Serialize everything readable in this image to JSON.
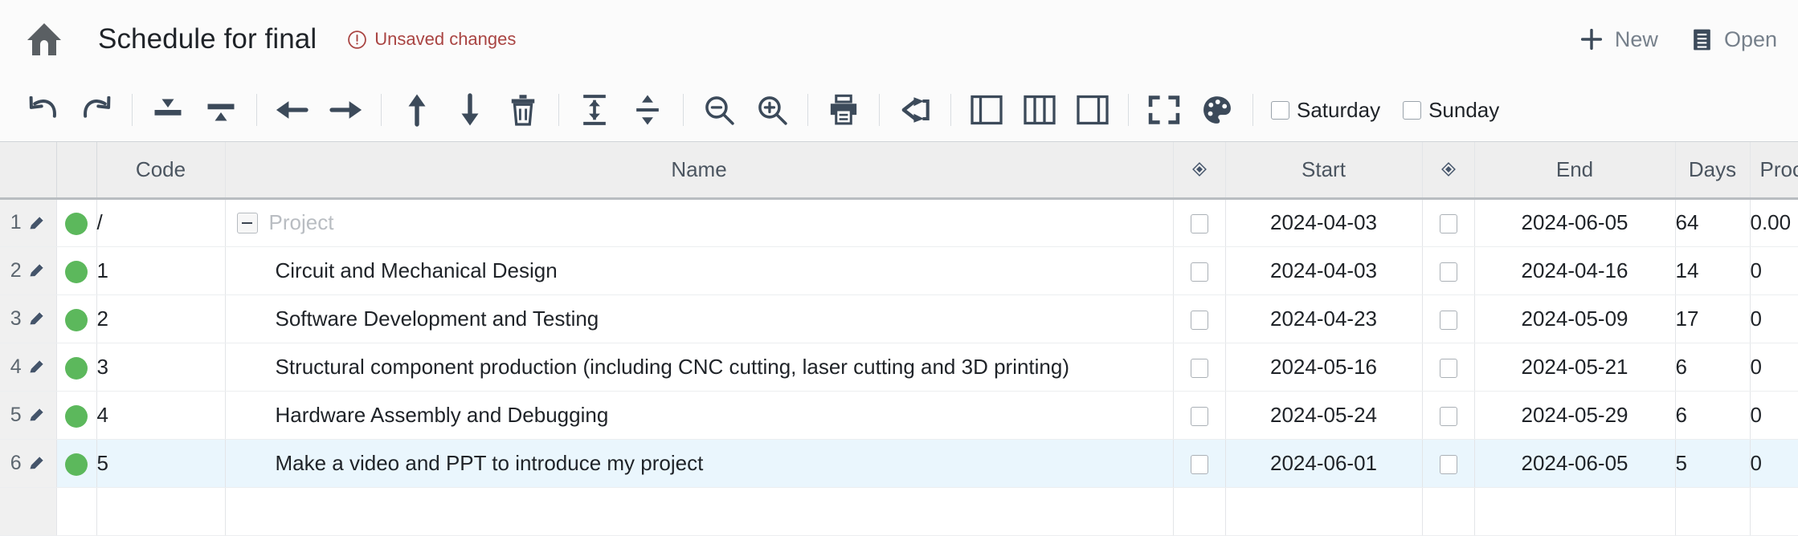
{
  "header": {
    "home_icon": "home-icon",
    "title": "Schedule for final",
    "unsaved_label": "Unsaved changes",
    "unsaved_color": "#a94442",
    "actions": [
      {
        "icon": "plus-icon",
        "label": "New"
      },
      {
        "icon": "document-icon",
        "label": "Open"
      }
    ]
  },
  "toolbar": {
    "groups": [
      {
        "buttons": [
          {
            "name": "undo-button",
            "icon": "undo-arrow-icon"
          },
          {
            "name": "redo-button",
            "icon": "redo-arrow-icon"
          }
        ]
      },
      {
        "buttons": [
          {
            "name": "insert-row-above-button",
            "icon": "insert-above-icon"
          },
          {
            "name": "insert-row-below-button",
            "icon": "insert-below-icon"
          }
        ]
      },
      {
        "buttons": [
          {
            "name": "outdent-button",
            "icon": "arrow-left-icon"
          },
          {
            "name": "indent-button",
            "icon": "arrow-right-icon"
          }
        ]
      },
      {
        "buttons": [
          {
            "name": "move-up-button",
            "icon": "arrow-up-icon"
          },
          {
            "name": "move-down-button",
            "icon": "arrow-down-icon"
          },
          {
            "name": "delete-row-button",
            "icon": "trash-icon"
          }
        ]
      },
      {
        "buttons": [
          {
            "name": "collapse-all-button",
            "icon": "collapse-rows-icon"
          },
          {
            "name": "expand-all-button",
            "icon": "expand-rows-icon"
          }
        ]
      },
      {
        "buttons": [
          {
            "name": "zoom-out-button",
            "icon": "magnifier-minus-icon"
          },
          {
            "name": "zoom-in-button",
            "icon": "magnifier-plus-icon"
          }
        ]
      },
      {
        "buttons": [
          {
            "name": "print-button",
            "icon": "printer-icon"
          }
        ]
      },
      {
        "buttons": [
          {
            "name": "dependency-button",
            "icon": "share-branch-icon"
          }
        ]
      },
      {
        "buttons": [
          {
            "name": "layout-grid-only-button",
            "icon": "panel-left-icon"
          },
          {
            "name": "layout-split-button",
            "icon": "panel-split-icon"
          },
          {
            "name": "layout-gantt-only-button",
            "icon": "panel-right-icon"
          }
        ]
      },
      {
        "buttons": [
          {
            "name": "fullscreen-button",
            "icon": "fullscreen-icon"
          },
          {
            "name": "theme-color-button",
            "icon": "palette-icon"
          }
        ]
      }
    ],
    "weekend_checkboxes": [
      {
        "name": "saturday-checkbox",
        "label": "Saturday",
        "checked": false
      },
      {
        "name": "sunday-checkbox",
        "label": "Sunday",
        "checked": false
      }
    ]
  },
  "table": {
    "columns": [
      {
        "key": "gutter",
        "label": ""
      },
      {
        "key": "status",
        "label": ""
      },
      {
        "key": "code",
        "label": "Code"
      },
      {
        "key": "name",
        "label": "Name"
      },
      {
        "key": "mile1",
        "label": "diamond-icon"
      },
      {
        "key": "start",
        "label": "Start"
      },
      {
        "key": "mile2",
        "label": "diamond-icon"
      },
      {
        "key": "end",
        "label": "End"
      },
      {
        "key": "days",
        "label": "Days"
      },
      {
        "key": "progress",
        "label": "Procress("
      }
    ],
    "rows": [
      {
        "num": "1",
        "code": "/",
        "name": "Project",
        "level": 0,
        "has_toggle": true,
        "toggle_state": "expanded",
        "start": "2024-04-03",
        "end": "2024-06-05",
        "days": "64",
        "progress": "0.00",
        "computed": true,
        "highlighted": false,
        "status_color": "#5cb85c"
      },
      {
        "num": "2",
        "code": "1",
        "name": "Circuit and Mechanical Design",
        "level": 1,
        "has_toggle": false,
        "toggle_state": "",
        "start": "2024-04-03",
        "end": "2024-04-16",
        "days": "14",
        "progress": "0",
        "computed": false,
        "highlighted": false,
        "status_color": "#5cb85c"
      },
      {
        "num": "3",
        "code": "2",
        "name": "Software Development and Testing",
        "level": 1,
        "has_toggle": false,
        "toggle_state": "",
        "start": "2024-04-23",
        "end": "2024-05-09",
        "days": "17",
        "progress": "0",
        "computed": false,
        "highlighted": false,
        "status_color": "#5cb85c"
      },
      {
        "num": "4",
        "code": "3",
        "name": "Structural component production (including CNC cutting, laser cutting and 3D printing)",
        "level": 1,
        "has_toggle": false,
        "toggle_state": "",
        "start": "2024-05-16",
        "end": "2024-05-21",
        "days": "6",
        "progress": "0",
        "computed": false,
        "highlighted": false,
        "status_color": "#5cb85c"
      },
      {
        "num": "5",
        "code": "4",
        "name": "Hardware Assembly and Debugging",
        "level": 1,
        "has_toggle": false,
        "toggle_state": "",
        "start": "2024-05-24",
        "end": "2024-05-29",
        "days": "6",
        "progress": "0",
        "computed": false,
        "highlighted": false,
        "status_color": "#5cb85c"
      },
      {
        "num": "6",
        "code": "5",
        "name": "Make a video and PPT to introduce my project",
        "level": 1,
        "has_toggle": false,
        "toggle_state": "",
        "start": "2024-06-01",
        "end": "2024-06-05",
        "days": "5",
        "progress": "0",
        "computed": false,
        "highlighted": true,
        "status_color": "#5cb85c"
      }
    ]
  }
}
